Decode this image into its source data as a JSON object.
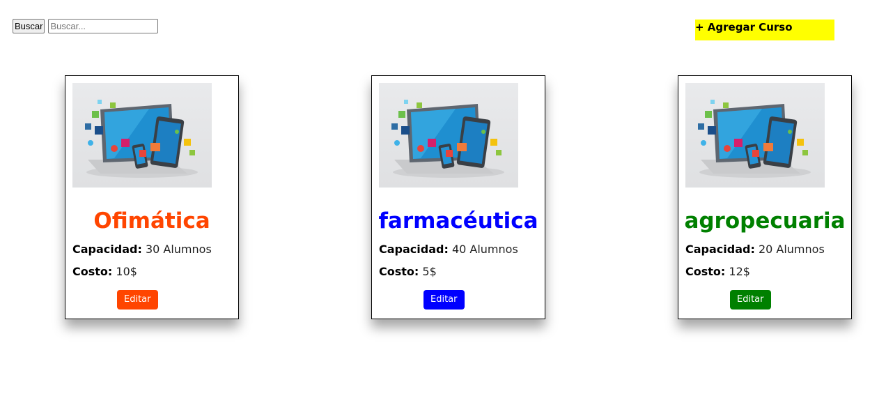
{
  "search": {
    "button_label": "Buscar",
    "placeholder": "Buscar...",
    "value": ""
  },
  "add_course": {
    "label": "+ Agregar Curso",
    "color": "#ffff00"
  },
  "image_icon": "devices-illustration",
  "cards": [
    {
      "title": "Ofimática",
      "color": "#ff4500",
      "capacity_label": "Capacidad:",
      "capacity_value": "30 Alumnos",
      "cost_label": "Costo:",
      "cost_value": "10$",
      "edit_label": "Editar"
    },
    {
      "title": "farmacéutica",
      "color": "#0000ff",
      "capacity_label": "Capacidad:",
      "capacity_value": "40 Alumnos",
      "cost_label": "Costo:",
      "cost_value": "5$",
      "edit_label": "Editar"
    },
    {
      "title": "agropecuaria",
      "color": "#008000",
      "capacity_label": "Capacidad:",
      "capacity_value": "20 Alumnos",
      "cost_label": "Costo:",
      "cost_value": "12$",
      "edit_label": "Editar"
    }
  ]
}
